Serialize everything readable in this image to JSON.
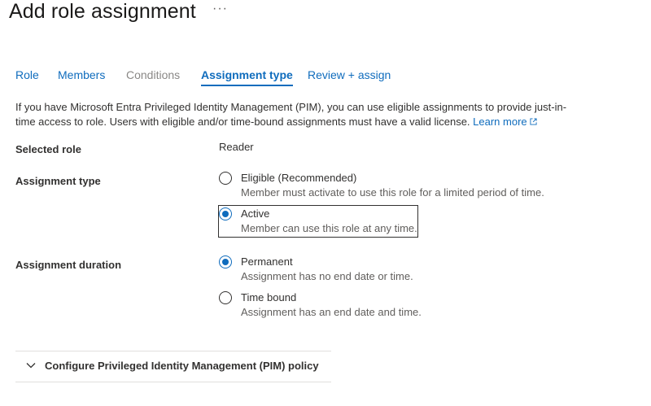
{
  "header": {
    "title": "Add role assignment",
    "more_label": "···"
  },
  "tabs": [
    {
      "label": "Role",
      "state": "enabled"
    },
    {
      "label": "Members",
      "state": "enabled"
    },
    {
      "label": "Conditions",
      "state": "disabled"
    },
    {
      "label": "Assignment type",
      "state": "selected"
    },
    {
      "label": "Review + assign",
      "state": "enabled"
    }
  ],
  "intro": {
    "text": "If you have Microsoft Entra Privileged Identity Management (PIM), you can use eligible assignments to provide just-in-time access to role. Users with eligible and/or time-bound assignments must have a valid license. ",
    "link": "Learn more",
    "link_icon": "external-link-icon"
  },
  "selected_role": {
    "label": "Selected role",
    "value": "Reader"
  },
  "assignment_type": {
    "label": "Assignment type",
    "options": [
      {
        "title": "Eligible (Recommended)",
        "description": "Member must activate to use this role for a limited period of time.",
        "checked": false
      },
      {
        "title": "Active",
        "description": "Member can use this role at any time.",
        "checked": true
      }
    ]
  },
  "assignment_duration": {
    "label": "Assignment duration",
    "options": [
      {
        "title": "Permanent",
        "description": "Assignment has no end date or time.",
        "checked": true
      },
      {
        "title": "Time bound",
        "description": "Assignment has an end date and time.",
        "checked": false
      }
    ]
  },
  "pim_policy": {
    "label": "Configure Privileged Identity Management (PIM) policy",
    "icon": "chevron-down-icon"
  },
  "colors": {
    "accent": "#0f6cbd",
    "disabled": "#8a8886",
    "text": "#323130",
    "secondary_text": "#605e5c"
  }
}
